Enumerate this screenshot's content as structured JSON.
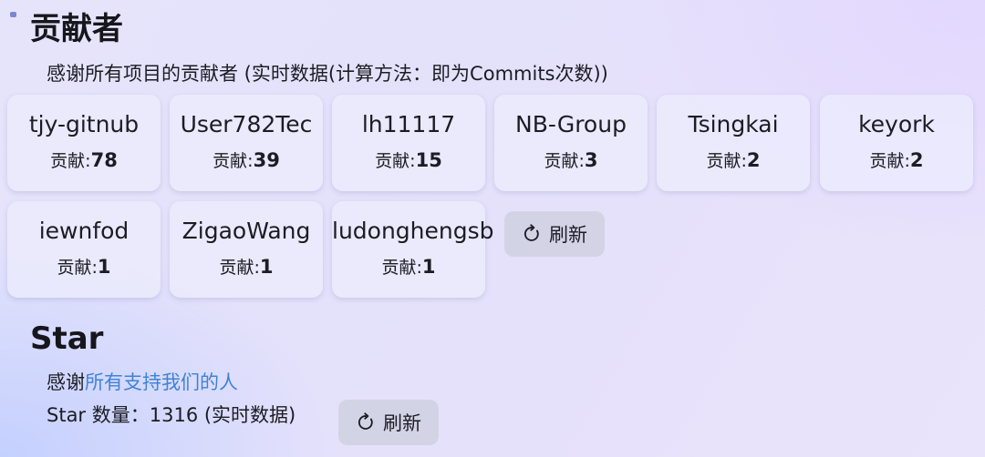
{
  "contributors": {
    "title": "贡献者",
    "description": "感谢所有项目的贡献者 (实时数据(计算方法：即为Commits次数))",
    "count_label": "贡献:",
    "items": [
      {
        "name": "tjy-gitnub",
        "count": "78"
      },
      {
        "name": "User782Tec",
        "count": "39"
      },
      {
        "name": "lh11117",
        "count": "15"
      },
      {
        "name": "NB-Group",
        "count": "3"
      },
      {
        "name": "Tsingkai",
        "count": "2"
      },
      {
        "name": "keyork",
        "count": "2"
      },
      {
        "name": "iewnfod",
        "count": "1"
      },
      {
        "name": "ZigaoWang",
        "count": "1"
      },
      {
        "name": "ludonghengsb",
        "count": "1"
      }
    ],
    "refresh_label": "刷新"
  },
  "star": {
    "title": "Star",
    "thanks_prefix": "感谢",
    "thanks_link": "所有支持我们的人",
    "count_line": "Star 数量：1316 (实时数据)",
    "refresh_label": "刷新"
  },
  "icons": {
    "refresh": "refresh-icon"
  },
  "colors": {
    "link": "#3f83d6"
  }
}
